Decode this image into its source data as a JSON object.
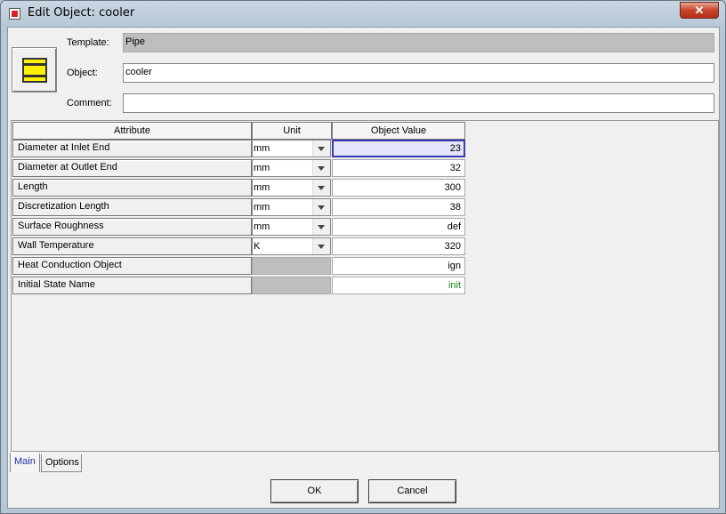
{
  "window": {
    "title": "Edit Object: cooler",
    "close_glyph": "✕"
  },
  "form": {
    "icon": "pipe-icon",
    "template_label": "Template:",
    "template_value": "Pipe",
    "object_label": "Object:",
    "object_value": "cooler",
    "comment_label": "Comment:",
    "comment_value": ""
  },
  "table": {
    "headers": [
      "Attribute",
      "Unit",
      "Object Value"
    ],
    "rows": [
      {
        "attribute": "Diameter at Inlet End",
        "unit": "mm",
        "value": "23"
      },
      {
        "attribute": "Diameter at Outlet End",
        "unit": "mm",
        "value": "32"
      },
      {
        "attribute": "Length",
        "unit": "mm",
        "value": "300"
      },
      {
        "attribute": "Discretization Length",
        "unit": "mm",
        "value": "38"
      },
      {
        "attribute": "Surface Roughness",
        "unit": "mm",
        "value": "def"
      },
      {
        "attribute": "Wall Temperature",
        "unit": "K",
        "value": "320"
      },
      {
        "attribute": "Heat Conduction Object",
        "unit": "",
        "value": "ign"
      },
      {
        "attribute": "Initial State Name",
        "unit": "",
        "value": "init"
      }
    ]
  },
  "tabs": [
    "Main",
    "Options"
  ],
  "buttons": {
    "ok": "OK",
    "cancel": "Cancel"
  },
  "colors": {
    "selected_cell_border": "#3a3ab0",
    "init_value": "#1a8a1a",
    "close_button": "#c7452c"
  }
}
